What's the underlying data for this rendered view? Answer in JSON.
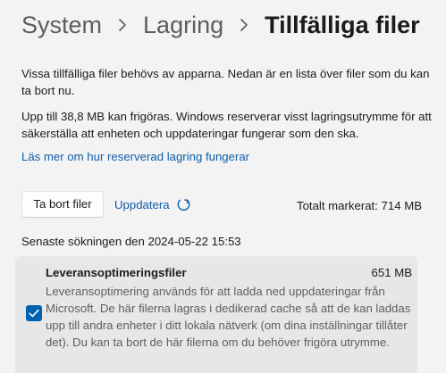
{
  "breadcrumb": {
    "items": [
      "System",
      "Lagring",
      "Tillfälliga filer"
    ]
  },
  "description": {
    "paragraph1": "Vissa tillfälliga filer behövs av apparna. Nedan är en lista över filer som du kan ta bort nu.",
    "paragraph2": "Upp till 38,8 MB kan frigöras. Windows reserverar visst lagringsutrymme för att säkerställa att enheten och uppdateringar fungerar som den ska.",
    "learn_more_link": "Läs mer om hur reserverad lagring fungerar"
  },
  "actions": {
    "remove_button": "Ta bort filer",
    "refresh_label": "Uppdatera",
    "total_selected": "Totalt markerat: 714 MB"
  },
  "last_scan": "Senaste sökningen den 2024-05-22 15:53",
  "items": [
    {
      "name": "Leveransoptimeringsfiler",
      "size": "651 MB",
      "checked": true,
      "description": "Leveransoptimering används för att ladda ned uppdateringar från Microsoft. De här filerna lagras i dedikerad cache så att de kan laddas upp till andra enheter i ditt lokala nätverk (om dina inställningar tillåter det). Du kan ta bort de här filerna om du behöver frigöra utrymme."
    }
  ],
  "colors": {
    "accent": "#0063b1",
    "link": "#0f5ea8",
    "background": "#f3f3f3",
    "card": "#e7e7e7"
  },
  "icons": {
    "breadcrumb_separator": "chevron-right-icon",
    "refresh": "refresh-icon",
    "checkbox": "checkmark-icon"
  }
}
